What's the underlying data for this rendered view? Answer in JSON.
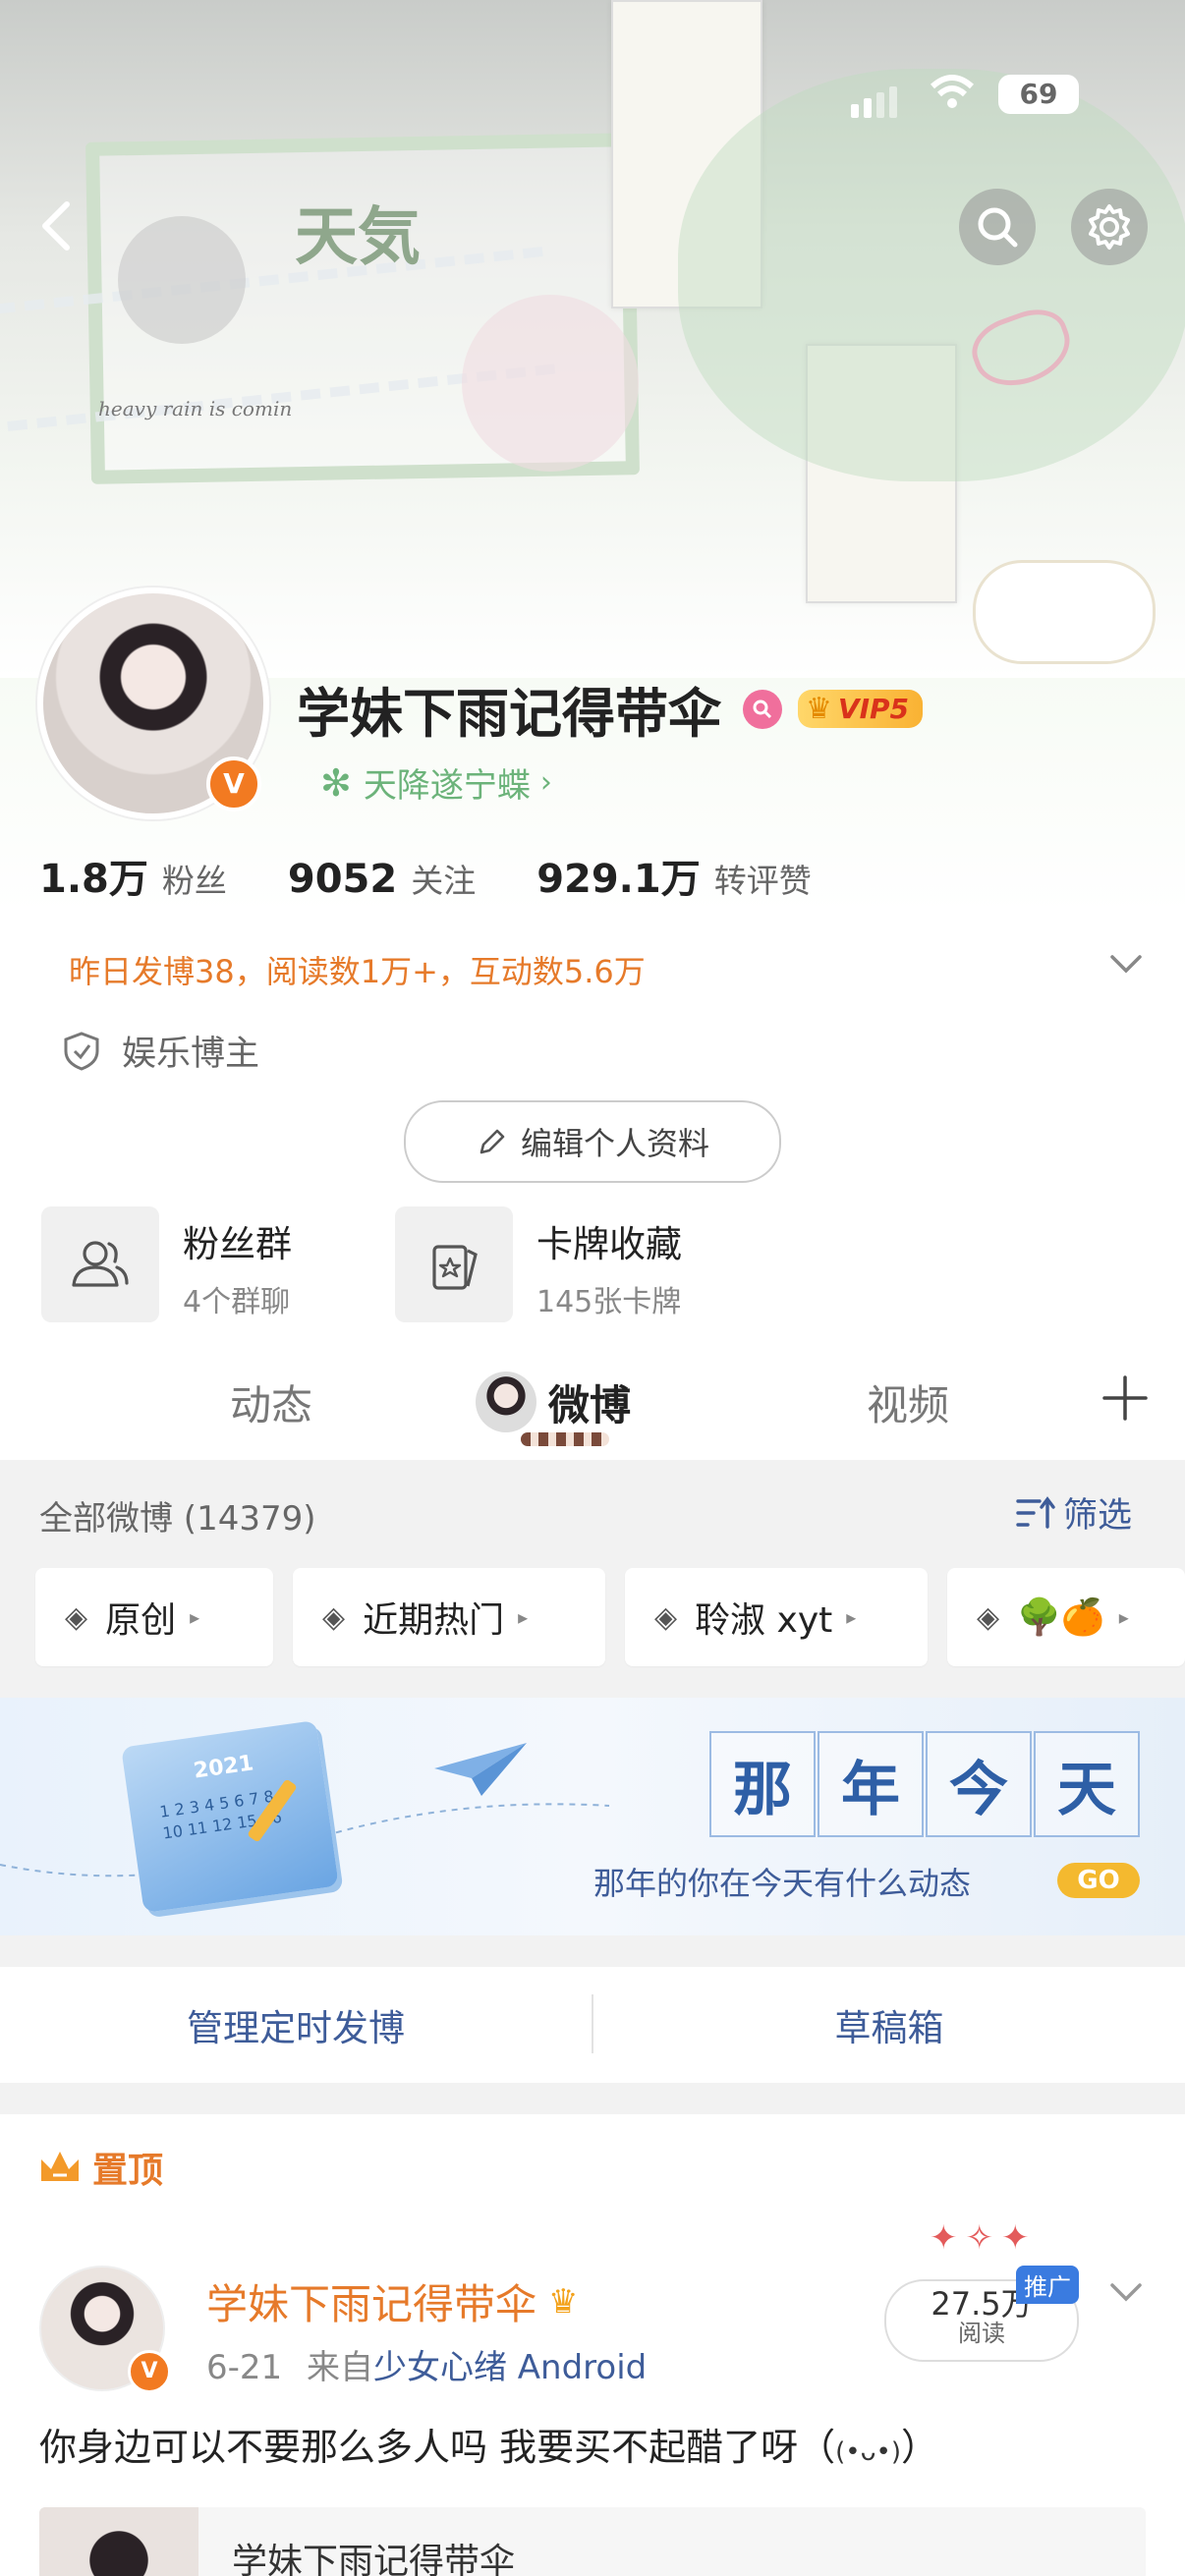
{
  "status_bar": {
    "battery": "69"
  },
  "header": {
    "banner_title": "天気",
    "banner_subtitle": "heavy rain is comin"
  },
  "profile": {
    "name": "学妹下雨记得带伞",
    "vip_label": "VIP5",
    "verified_mark": "V",
    "group_label": "天降遂宁蝶",
    "stats": [
      {
        "value": "1.8万",
        "label": "粉丝"
      },
      {
        "value": "9052",
        "label": "关注"
      },
      {
        "value": "929.1万",
        "label": "转评赞"
      }
    ],
    "summary": "昨日发博38，阅读数1万+，互动数5.6万",
    "tag": "娱乐博主",
    "edit_button": "编辑个人资料"
  },
  "shortcuts": [
    {
      "title": "粉丝群",
      "sub": "4个群聊",
      "icon": "group-icon"
    },
    {
      "title": "卡牌收藏",
      "sub": "145张卡牌",
      "icon": "card-icon"
    }
  ],
  "tabs": [
    {
      "label": "动态",
      "active": false
    },
    {
      "label": "微博",
      "active": true
    },
    {
      "label": "视频",
      "active": false
    }
  ],
  "feed_header": {
    "count_label": "全部微博 (14379)",
    "filter_label": "筛选"
  },
  "filters": [
    {
      "label": "原创"
    },
    {
      "label": "近期热门"
    },
    {
      "label": "聆淑 xyt"
    },
    {
      "label": "🌳🍊"
    }
  ],
  "banner": {
    "chars": [
      "那",
      "年",
      "今",
      "天"
    ],
    "subtitle": "那年的你在今天有什么动态",
    "go": "GO",
    "calendar_year": "2021",
    "calendar_nums": "1 2 3 4 5 6 7 8 9 10 11 12 15 16"
  },
  "actions": {
    "scheduled": "管理定时发博",
    "drafts": "草稿箱"
  },
  "pinned": {
    "label": "置顶"
  },
  "post": {
    "author": "学妹下雨记得带伞",
    "date": "6-21",
    "source_prefix": "来自",
    "source": "少女心绪",
    "device": "Android",
    "views_num": "27.5万",
    "views_label": "阅读",
    "promo_label": "推广",
    "text": "你身边可以不要那么多人吗 我要买不起醋了呀（",
    "text_end": "）",
    "emoji": "(•ᴗ•)",
    "quoted_name": "学妹下雨记得带伞"
  },
  "colors": {
    "accent_orange": "#f27a21",
    "link_blue": "#3e5c99",
    "summary_orange": "#e67a2a",
    "green": "#6cb37a"
  }
}
